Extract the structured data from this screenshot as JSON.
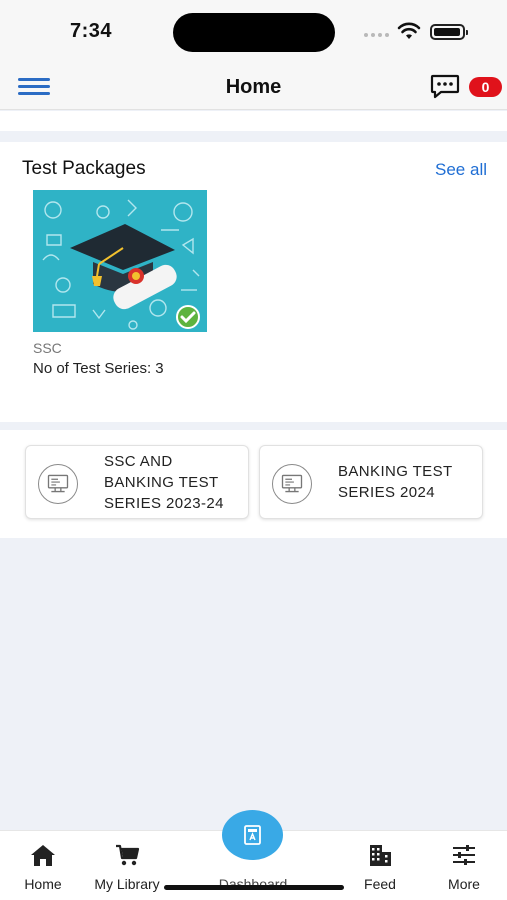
{
  "status_bar": {
    "time": "7:34"
  },
  "header": {
    "title": "Home",
    "chat_badge": "0"
  },
  "test_packages": {
    "title": "Test Packages",
    "see_all": "See all",
    "items": [
      {
        "category": "SSC",
        "count_label": "No of Test Series: 3"
      }
    ]
  },
  "series_cards": [
    {
      "line1": "SSC AND",
      "line2": "BANKING TEST",
      "line3": "SERIES 2023-24"
    },
    {
      "line1": "BANKING TEST",
      "line2": "SERIES 2024"
    }
  ],
  "tab_bar": {
    "tabs": [
      {
        "label": "Home",
        "icon": "home-icon"
      },
      {
        "label": "My Library",
        "icon": "cart-icon"
      },
      {
        "label": "Dashboard",
        "icon": "dashboard-icon"
      },
      {
        "label": "Feed",
        "icon": "building-icon"
      },
      {
        "label": "More",
        "icon": "sliders-icon"
      }
    ]
  },
  "colors": {
    "accent": "#1f6ed4",
    "badge": "#e0121b",
    "fab": "#39a9e6",
    "thumb": "#2fb3c6"
  }
}
